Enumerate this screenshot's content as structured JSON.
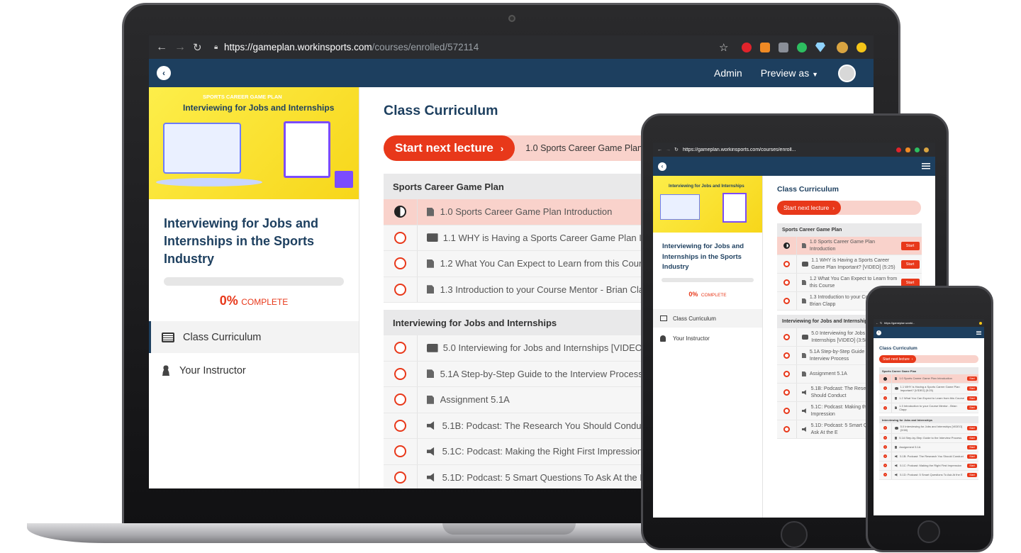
{
  "browser": {
    "url_host": "https://gameplan.workinsports.com",
    "url_path": "/courses/enrolled/572114",
    "tablet_url": "https://gameplan.workinsports.com/courses/enroll...",
    "phone_url": "https://gameplan.worki..."
  },
  "header": {
    "admin": "Admin",
    "preview": "Preview as"
  },
  "course": {
    "thumb_brand": "SPORTS CAREER GAME PLAN",
    "thumb_title": "Interviewing for Jobs and Internships",
    "title": "Interviewing for Jobs and Internships in the Sports Industry",
    "progress_value": "0%",
    "progress_label": "COMPLETE",
    "progress_fraction": 0
  },
  "sidebar": {
    "items": [
      {
        "label": "Class Curriculum"
      },
      {
        "label": "Your Instructor"
      }
    ]
  },
  "main": {
    "heading": "Class Curriculum",
    "start_button": "Start next lecture",
    "next_lecture": "1.0 Sports Career Game Plan Introduction",
    "row_button": "Start",
    "sections": [
      {
        "title": "Sports Career Game Plan",
        "lectures": [
          {
            "type": "doc",
            "title": "1.0 Sports Career Game Plan Introduction",
            "state": "in-progress"
          },
          {
            "type": "video",
            "title": "1.1 WHY is Having a Sports Career Game Plan Important? [VIDEO] (5:25)",
            "state": "todo"
          },
          {
            "type": "doc",
            "title": "1.2 What You Can Expect to Learn from this Course",
            "state": "todo"
          },
          {
            "type": "doc",
            "title": "1.3 Introduction to your Course Mentor - Brian Clapp",
            "state": "todo"
          }
        ]
      },
      {
        "title": "Interviewing for Jobs and Internships",
        "lectures": [
          {
            "type": "video",
            "title": "5.0 Interviewing for Jobs and Internships [VIDEO] (3:58)",
            "state": "todo"
          },
          {
            "type": "doc",
            "title": "5.1A Step-by-Step Guide to the Interview Process",
            "state": "todo"
          },
          {
            "type": "doc",
            "title": "Assignment 5.1A",
            "state": "todo"
          },
          {
            "type": "audio",
            "title": "5.1B: Podcast: The Research You Should Conduct",
            "state": "todo"
          },
          {
            "type": "audio",
            "title": "5.1C: Podcast: Making the Right First Impression",
            "state": "todo"
          },
          {
            "type": "audio",
            "title": "5.1D: Podcast: 5 Smart Questions To Ask At the E",
            "state": "todo"
          }
        ]
      }
    ]
  },
  "colors": {
    "accent": "#e8381a",
    "navy": "#1d3f5f",
    "header": "#1d3f5f",
    "highlight": "#f9d2cb"
  },
  "icons": [
    "back-arrow-icon",
    "forward-arrow-icon",
    "reload-icon",
    "lock-icon",
    "star-icon",
    "pinterest-icon",
    "rss-icon",
    "code-icon",
    "evernote-icon",
    "diamond-icon",
    "extension-icon",
    "avatar-icon",
    "curriculum-icon",
    "instructor-icon",
    "hamburger-icon",
    "home-button-icon"
  ]
}
